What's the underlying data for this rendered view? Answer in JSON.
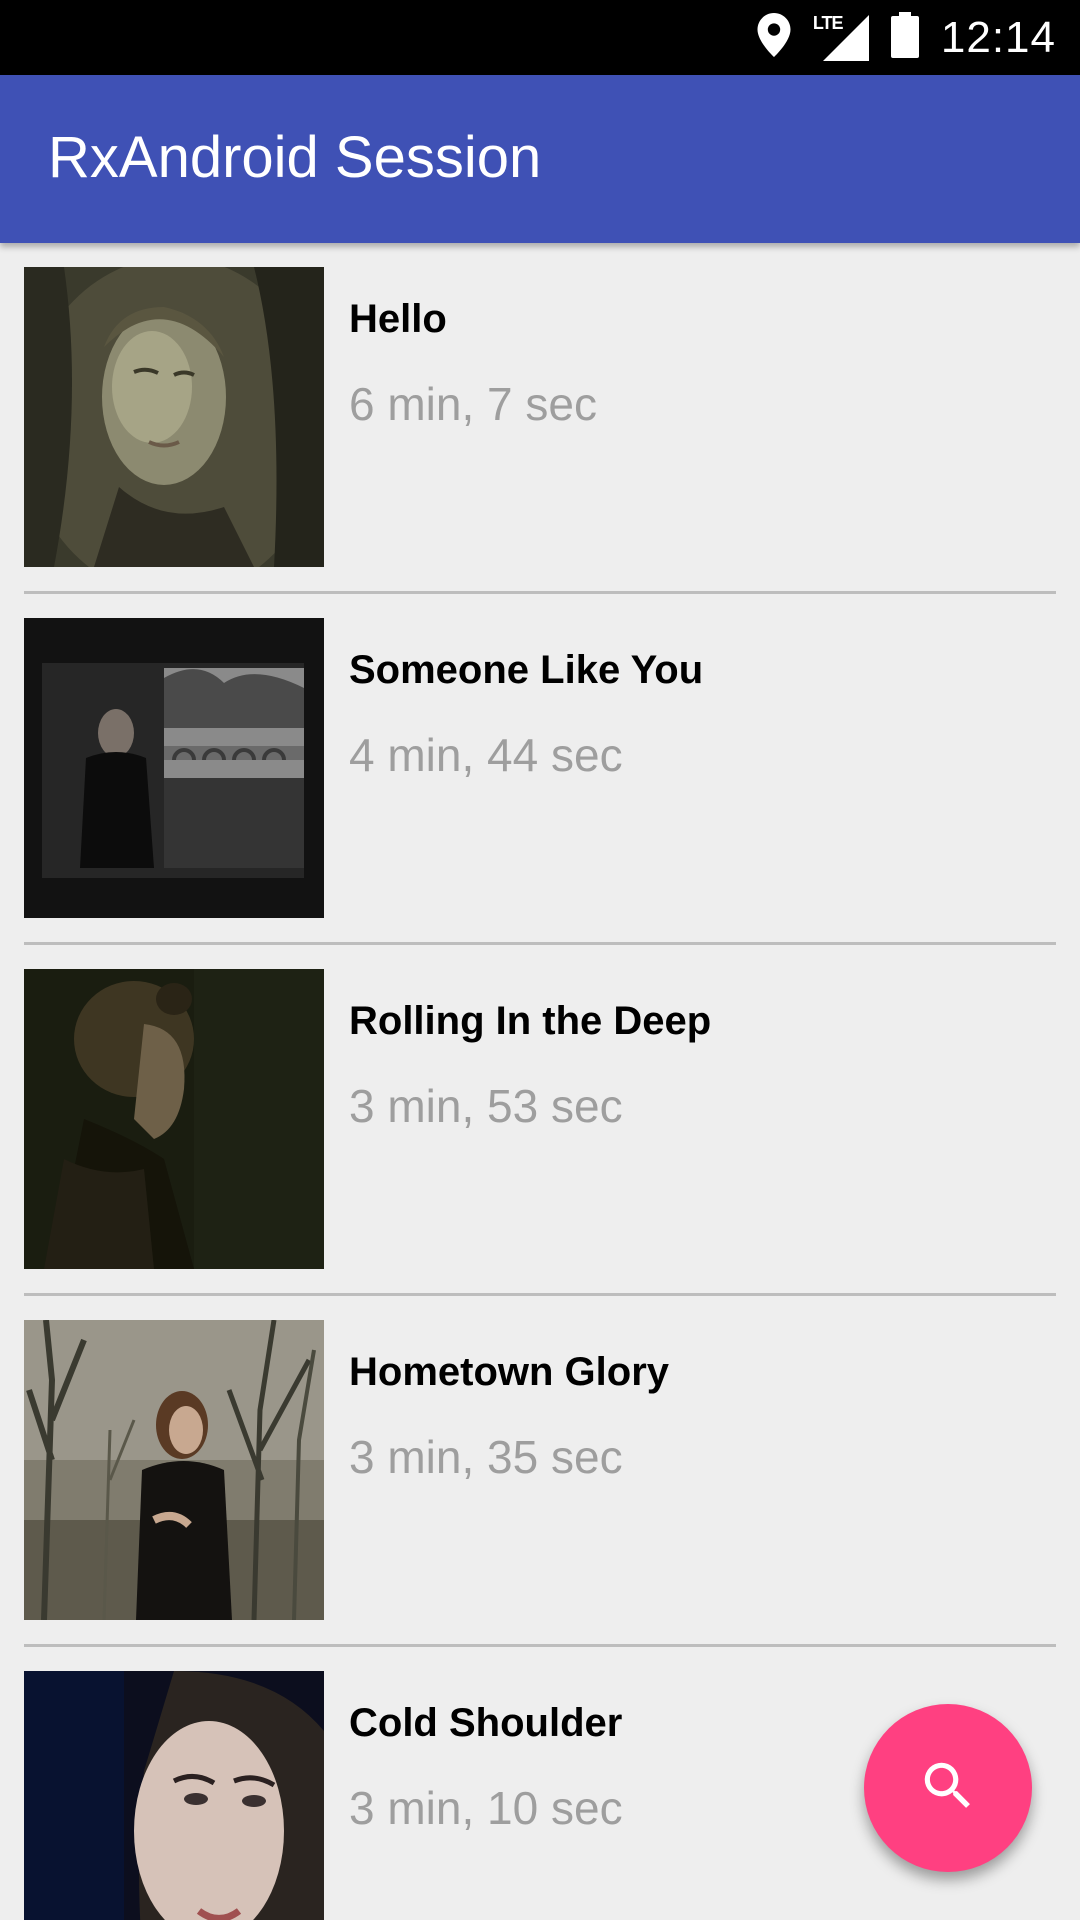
{
  "status_bar": {
    "time": "12:14",
    "network": "LTE",
    "icons": [
      "location-icon",
      "lte-signal-icon",
      "battery-icon"
    ]
  },
  "app_bar": {
    "title": "RxAndroid Session",
    "color": "#3f51b5"
  },
  "videos": [
    {
      "title": "Hello",
      "duration": "6 min, 7 sec"
    },
    {
      "title": "Someone Like You",
      "duration": "4 min, 44 sec"
    },
    {
      "title": "Rolling In the Deep",
      "duration": "3 min, 53 sec"
    },
    {
      "title": "Hometown Glory",
      "duration": "3 min, 35 sec"
    },
    {
      "title": "Cold Shoulder",
      "duration": "3 min, 10 sec"
    }
  ],
  "fab": {
    "icon": "search-icon",
    "color": "#ff4081"
  },
  "colors": {
    "background": "#eeeeee",
    "title_text": "#000000",
    "duration_text": "#9e9e9e",
    "divider": "#bdbdbd"
  }
}
